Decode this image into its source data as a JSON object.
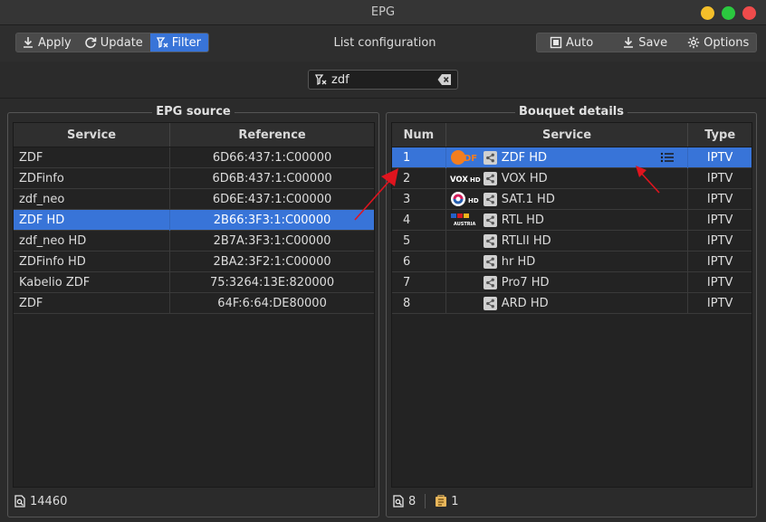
{
  "window": {
    "title": "EPG"
  },
  "toolbar": {
    "apply_label": "Apply",
    "update_label": "Update",
    "filter_label": "Filter",
    "center_label": "List configuration",
    "auto_label": "Auto",
    "save_label": "Save",
    "options_label": "Options"
  },
  "search": {
    "value": "zdf"
  },
  "epg_source": {
    "title": "EPG source",
    "columns": [
      "Service",
      "Reference"
    ],
    "rows": [
      {
        "service": "ZDF",
        "reference": "6D66:437:1:C00000"
      },
      {
        "service": "ZDFinfo",
        "reference": "6D6B:437:1:C00000"
      },
      {
        "service": "zdf_neo",
        "reference": "6D6E:437:1:C00000"
      },
      {
        "service": "ZDF HD",
        "reference": "2B66:3F3:1:C00000",
        "selected": true
      },
      {
        "service": "zdf_neo HD",
        "reference": "2B7A:3F3:1:C00000"
      },
      {
        "service": "ZDFinfo HD",
        "reference": "2BA2:3F2:1:C00000"
      },
      {
        "service": "Kabelio ZDF",
        "reference": "75:3264:13E:820000"
      },
      {
        "service": "ZDF",
        "reference": "64F:6:64:DE80000"
      }
    ],
    "count": "14460"
  },
  "bouquet": {
    "title": "Bouquet details",
    "columns": [
      "Num",
      "Service",
      "Type"
    ],
    "rows": [
      {
        "num": "1",
        "service": "ZDF HD",
        "type": "IPTV",
        "logo": "ZDF",
        "selected": true
      },
      {
        "num": "2",
        "service": "VOX HD",
        "type": "IPTV",
        "logo": "VOX HD"
      },
      {
        "num": "3",
        "service": "SAT.1 HD",
        "type": "IPTV",
        "logo": "HD"
      },
      {
        "num": "4",
        "service": "RTL HD",
        "type": "IPTV",
        "logo": "AUSTRIA"
      },
      {
        "num": "5",
        "service": "RTLII HD",
        "type": "IPTV",
        "logo": ""
      },
      {
        "num": "6",
        "service": "hr HD",
        "type": "IPTV",
        "logo": ""
      },
      {
        "num": "7",
        "service": "Pro7 HD",
        "type": "IPTV",
        "logo": ""
      },
      {
        "num": "8",
        "service": "ARD HD",
        "type": "IPTV",
        "logo": ""
      }
    ],
    "count": "8",
    "secondary_count": "1"
  },
  "colors": {
    "accent": "#3874d8",
    "arrow": "#e0141e"
  },
  "icons": [
    "download-icon",
    "refresh-icon",
    "filter-icon",
    "auto-icon",
    "save-icon",
    "gear-icon",
    "clear-icon",
    "share-icon",
    "list-icon",
    "search-count-icon",
    "bouquet-count-icon"
  ]
}
